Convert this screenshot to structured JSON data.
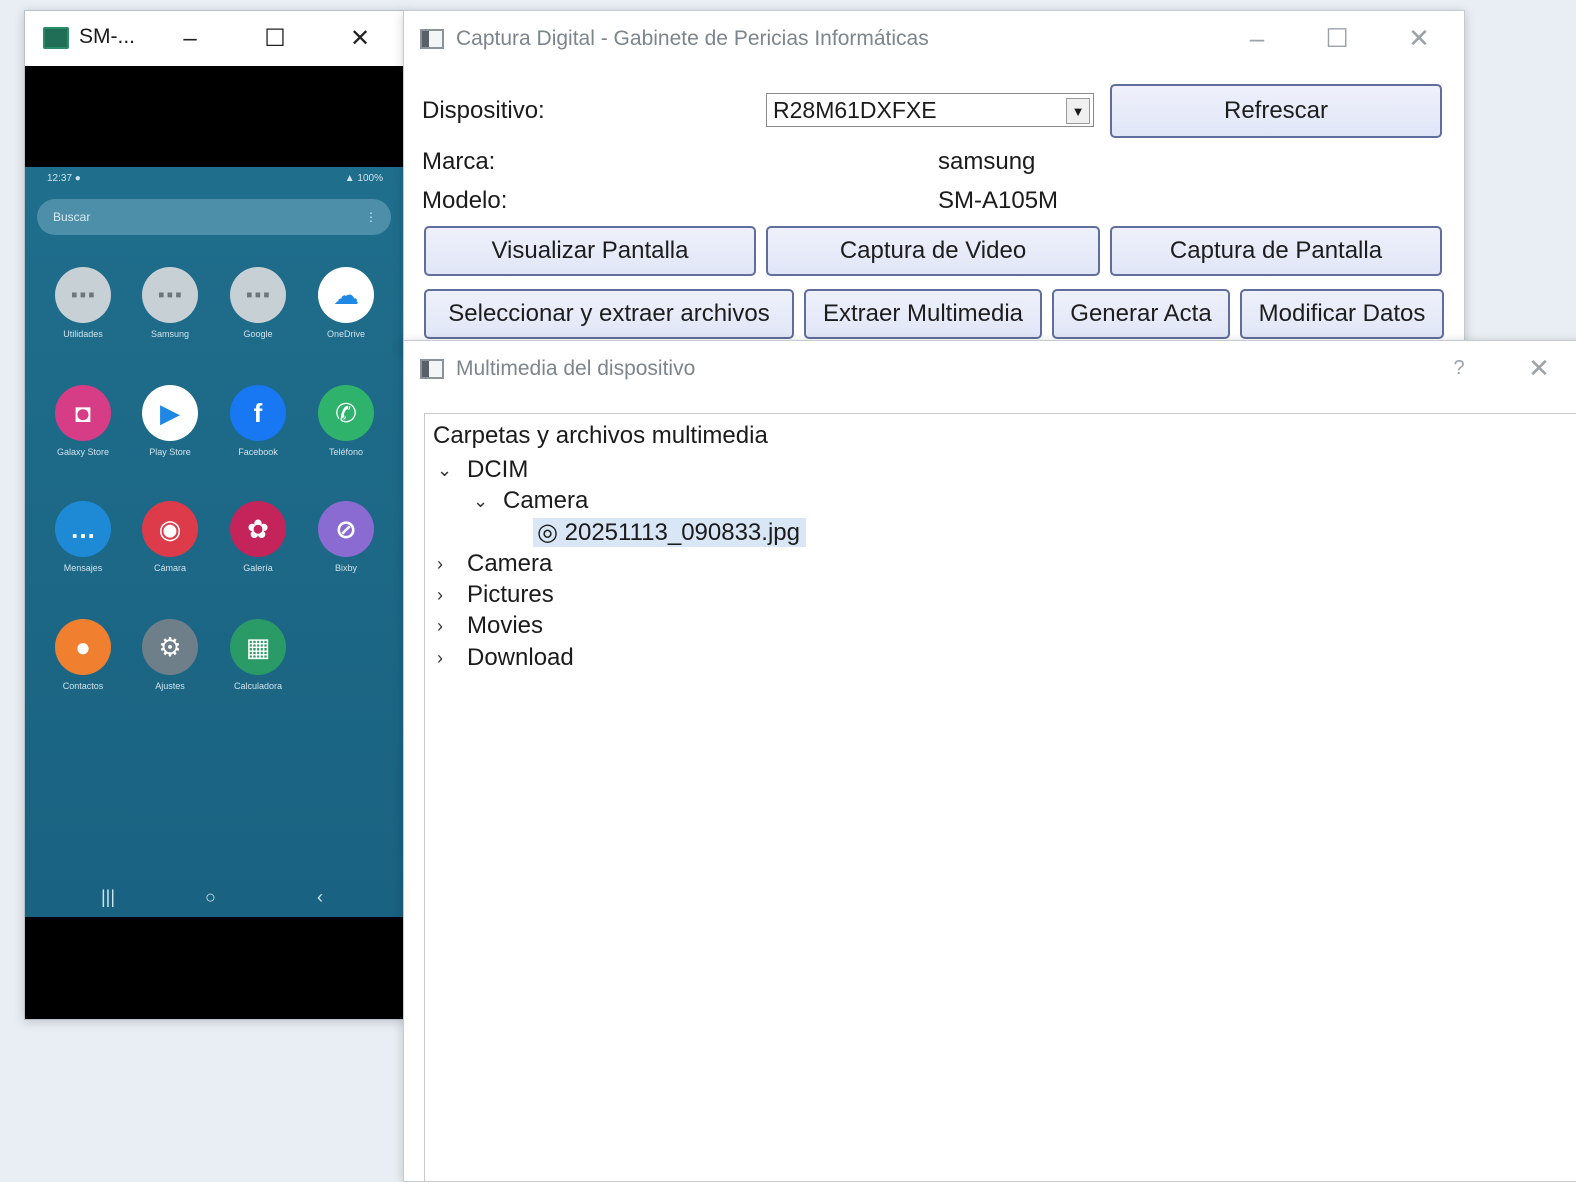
{
  "phone_window": {
    "title": "SM-...",
    "minimize": "–",
    "maximize": "☐",
    "close": "✕",
    "status_left": "12:37 ●",
    "status_right": "▲ 100%",
    "search_placeholder": "Buscar",
    "search_more": "⋮",
    "apps": [
      {
        "label": "Utilidades",
        "icon": "folder-icon",
        "color": "#c7d0d4",
        "glyph": "⋯"
      },
      {
        "label": "Samsung",
        "icon": "folder-icon",
        "color": "#c7d0d4",
        "glyph": "⋯"
      },
      {
        "label": "Google",
        "icon": "folder-icon",
        "color": "#c7d0d4",
        "glyph": "⋯"
      },
      {
        "label": "OneDrive",
        "icon": "cloud-icon",
        "color": "#ffffff",
        "glyph": "☁"
      },
      {
        "label": "Galaxy Store",
        "icon": "bag-icon",
        "color": "#d63d86",
        "glyph": "◘"
      },
      {
        "label": "Play Store",
        "icon": "play-icon",
        "color": "#ffffff",
        "glyph": "▶"
      },
      {
        "label": "Facebook",
        "icon": "facebook-icon",
        "color": "#1877f2",
        "glyph": "f"
      },
      {
        "label": "Teléfono",
        "icon": "phone-icon",
        "color": "#2fb36c",
        "glyph": "✆"
      },
      {
        "label": "Mensajes",
        "icon": "messages-icon",
        "color": "#1e8ad6",
        "glyph": "…"
      },
      {
        "label": "Cámara",
        "icon": "camera-icon",
        "color": "#dd3b4a",
        "glyph": "◉"
      },
      {
        "label": "Galería",
        "icon": "gallery-icon",
        "color": "#c4245a",
        "glyph": "✿"
      },
      {
        "label": "Bixby",
        "icon": "bixby-icon",
        "color": "#8a6bd1",
        "glyph": "⊘"
      },
      {
        "label": "Contactos",
        "icon": "contacts-icon",
        "color": "#f08030",
        "glyph": "●"
      },
      {
        "label": "Ajustes",
        "icon": "settings-icon",
        "color": "#6e7f89",
        "glyph": "⚙"
      },
      {
        "label": "Calculadora",
        "icon": "calculator-icon",
        "color": "#2a9a66",
        "glyph": "▦"
      }
    ],
    "nav_recent": "|||",
    "nav_home": "○",
    "nav_back": "‹"
  },
  "main_window": {
    "title": "Captura Digital - Gabinete de Pericias Informáticas",
    "minimize": "–",
    "maximize": "☐",
    "close": "✕",
    "device_label": "Dispositivo:",
    "device_value": "R28M61DXFXE",
    "refresh_button": "Refrescar",
    "brand_label": "Marca:",
    "brand_value": "samsung",
    "model_label": "Modelo:",
    "model_value": "SM-A105M",
    "buttons_row1": [
      "Visualizar Pantalla",
      "Captura de Video",
      "Captura de Pantalla"
    ],
    "buttons_row2": [
      "Seleccionar y extraer archivos",
      "Extraer Multimedia",
      "Generar Acta",
      "Modificar Datos"
    ]
  },
  "dialog": {
    "title": "Multimedia del dispositivo",
    "help": "?",
    "close": "✕",
    "tree_header": "Carpetas y archivos multimedia",
    "tree": {
      "expanded": "⌄",
      "collapsed": "›",
      "dcim": "DCIM",
      "camera": "Camera",
      "file": "20251113_090833.jpg",
      "file_icon": "◎",
      "others": [
        "Camera",
        "Pictures",
        "Movies",
        "Download"
      ]
    }
  }
}
